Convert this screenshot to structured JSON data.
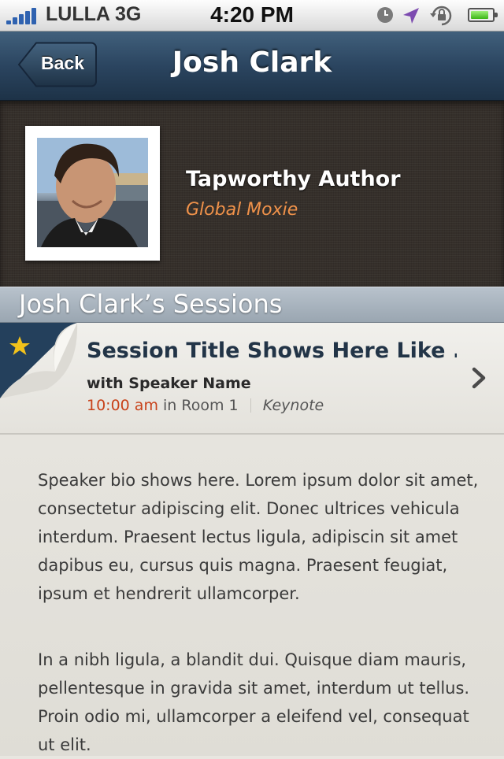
{
  "status_bar": {
    "carrier": "LULLA 3G",
    "time": "4:20 PM",
    "battery_level": 0.85,
    "icons": [
      "signal-bars-icon",
      "clock-icon",
      "location-arrow-icon",
      "rotation-lock-icon",
      "battery-icon"
    ]
  },
  "nav": {
    "back_label": "Back",
    "title": "Josh Clark"
  },
  "profile": {
    "title": "Tapworthy Author",
    "organization": "Global Moxie"
  },
  "section": {
    "title": "Josh Clark’s Sessions"
  },
  "sessions": [
    {
      "title": "Session Title Shows Here Like ...",
      "speaker": "with Speaker Name",
      "time": "10:00 am",
      "room": "in Room 1",
      "type": "Keynote",
      "favorite": true
    }
  ],
  "bio": {
    "paragraphs": [
      "Speaker bio shows here. Lorem ipsum dolor sit amet, consectetur adipiscing elit. Donec ultrices vehicula interdum. Praesent lectus ligula, adipiscin sit amet dapibus eu, cursus quis magna. Praesent feugiat, ipsum et hendrerit ullamcorper.",
      "In a nibh ligula, a blandit dui. Quisque diam mauris, pellentesque in gravida sit amet, interdum ut tellus. Proin odio mi, ullamcorper a eleifend vel, consequat ut elit."
    ]
  },
  "colors": {
    "nav_bar": "#2b4560",
    "accent_orange": "#f0924a",
    "time_red": "#c8421a",
    "title_navy": "#223447",
    "star_gold": "#f2c21b"
  }
}
